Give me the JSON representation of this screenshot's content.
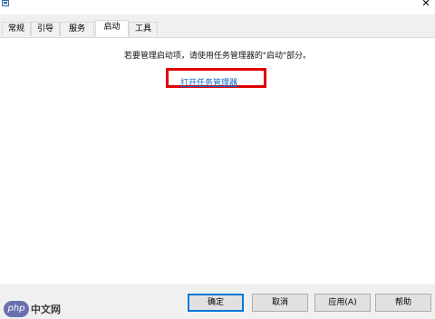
{
  "window": {
    "close_glyph": "✕"
  },
  "tabs": [
    "常规",
    "引导",
    "服务",
    "启动",
    "工具"
  ],
  "active_tab": "启动",
  "startup": {
    "message": "若要管理启动项，请使用任务管理器的\"启动\"部分。",
    "link": "打开任务管理器"
  },
  "buttons": {
    "ok": "确定",
    "cancel": "取消",
    "apply": "应用(A)",
    "help": "帮助"
  },
  "watermark": {
    "badge": "php",
    "text": "中文网"
  },
  "colors": {
    "highlight": "#e00000",
    "link": "#0b66c2",
    "default_button_border": "#0078d7"
  }
}
